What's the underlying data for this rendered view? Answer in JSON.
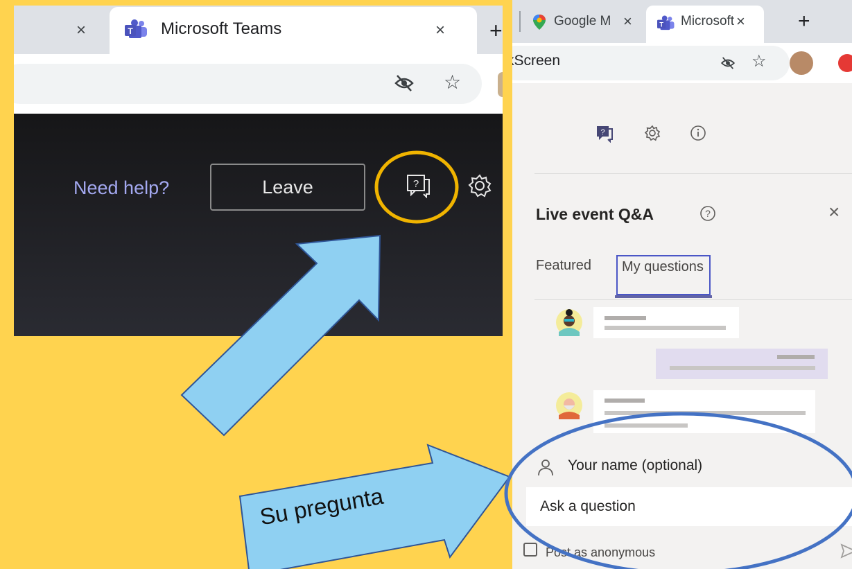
{
  "left": {
    "active_tab_title": "Microsoft Teams",
    "tab_close": "×",
    "new_tab": "+",
    "need_help": "Need help?",
    "leave_label": "Leave"
  },
  "right": {
    "tabs": [
      {
        "label": "Google M",
        "close": "×"
      },
      {
        "label": "Microsoft",
        "close": "×"
      }
    ],
    "new_tab": "+",
    "url_fragment": "kScreen",
    "panel_title": "Live event Q&A",
    "close": "×",
    "tab_featured": "Featured",
    "tab_my_questions": "My questions",
    "name_placeholder": "Your name (optional)",
    "ask_placeholder": "Ask a question",
    "anonymous_label": "Post as anonymous"
  },
  "annotation": {
    "arrow_text": "Su pregunta",
    "highlight_color": "#f0b400",
    "ellipse_color": "#4472c4",
    "arrow_fill": "#8fd0f2",
    "arrow_stroke": "#2f5597"
  },
  "icons": [
    "teams-icon",
    "hidden-eye-icon",
    "star-icon",
    "qa-chat-icon",
    "gear-icon",
    "info-icon",
    "help-icon",
    "person-icon",
    "send-icon",
    "maps-pin-icon"
  ]
}
